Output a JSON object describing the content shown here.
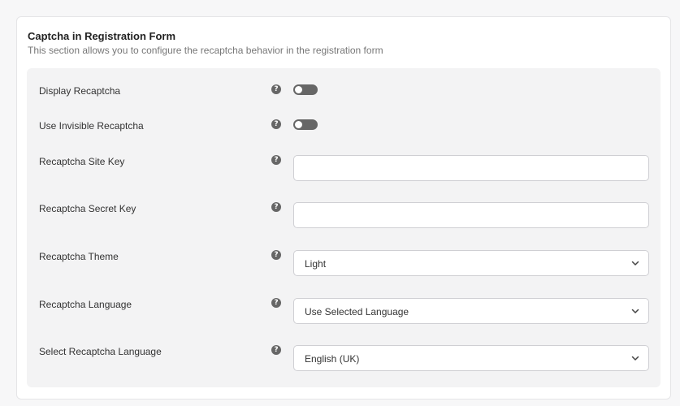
{
  "section": {
    "title": "Captcha in Registration Form",
    "subtitle": "This section allows you to configure the recaptcha behavior in the registration form"
  },
  "fields": {
    "display_recaptcha": {
      "label": "Display Recaptcha",
      "enabled": false
    },
    "use_invisible": {
      "label": "Use Invisible Recaptcha",
      "enabled": false
    },
    "site_key": {
      "label": "Recaptcha Site Key",
      "value": ""
    },
    "secret_key": {
      "label": "Recaptcha Secret Key",
      "value": ""
    },
    "theme": {
      "label": "Recaptcha Theme",
      "selected": "Light"
    },
    "language": {
      "label": "Recaptcha Language",
      "selected": "Use Selected Language"
    },
    "select_language": {
      "label": "Select Recaptcha Language",
      "selected": "English (UK)"
    }
  },
  "icons": {
    "help": "question-circle-icon",
    "chevron": "chevron-down-icon"
  },
  "colors": {
    "toggle_off": "#666666",
    "panel_bg": "#f3f3f4"
  }
}
